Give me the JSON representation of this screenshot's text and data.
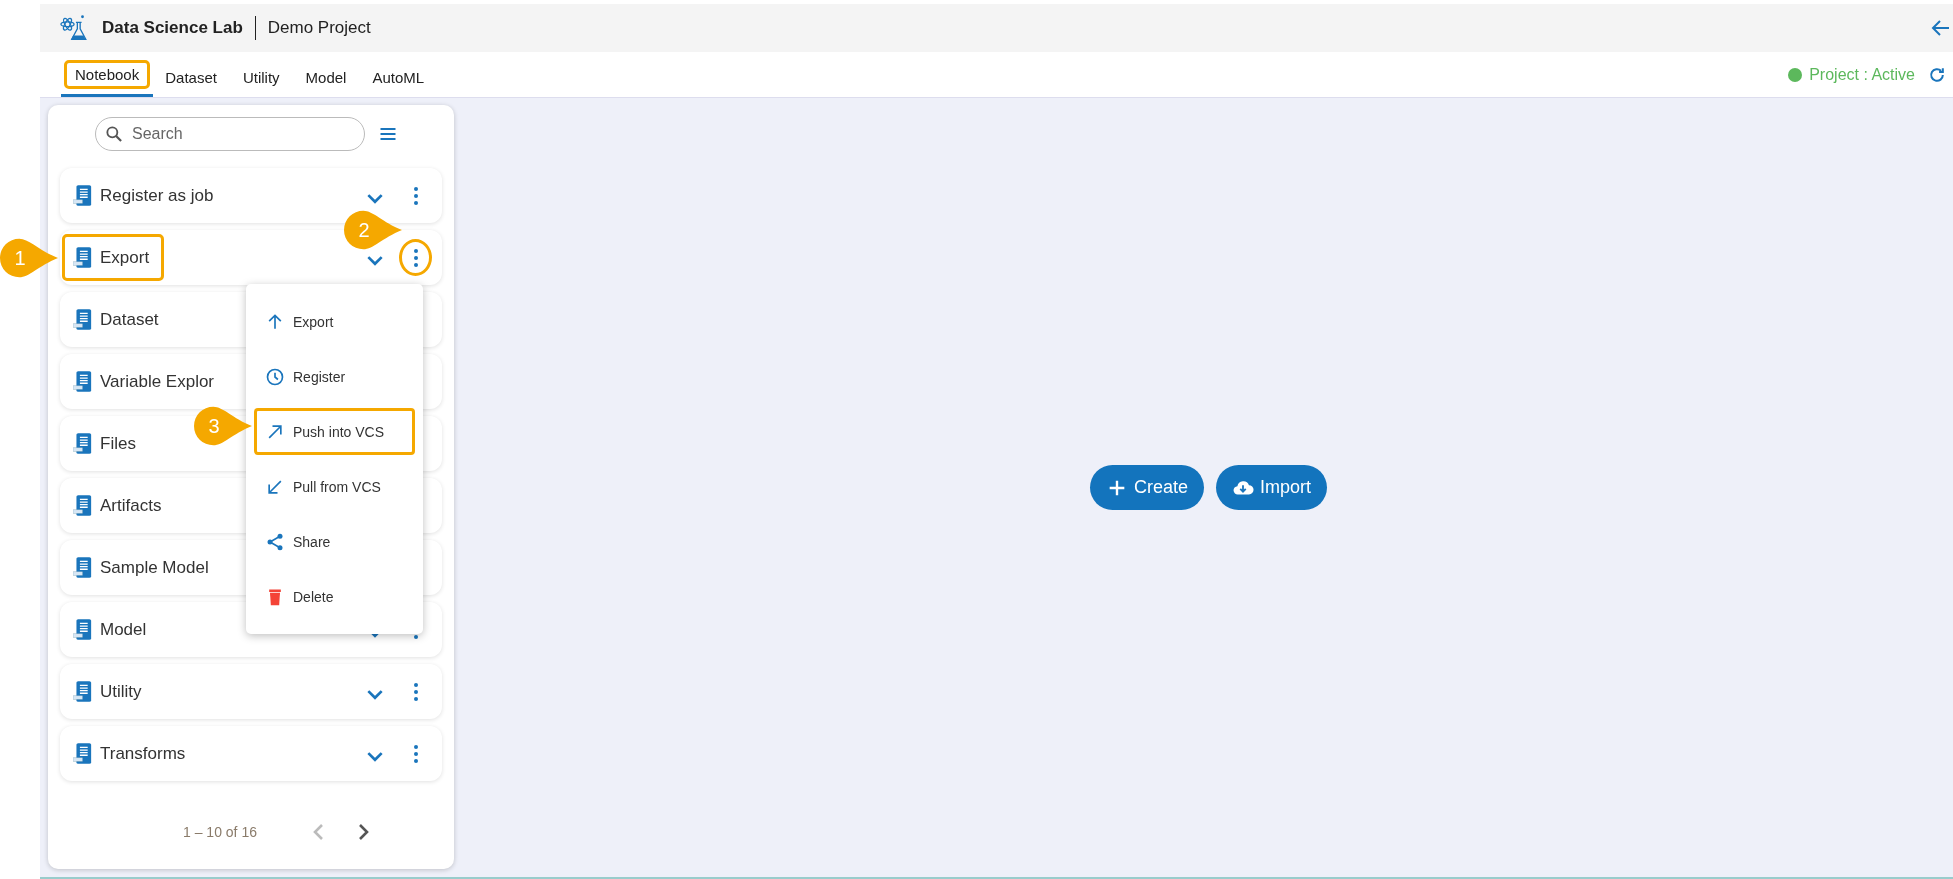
{
  "header": {
    "app_title": "Data Science Lab",
    "project_name": "Demo Project"
  },
  "tabs": [
    {
      "label": "Notebook",
      "selected": true,
      "highlighted": true
    },
    {
      "label": "Dataset",
      "selected": false,
      "highlighted": false
    },
    {
      "label": "Utility",
      "selected": false,
      "highlighted": false
    },
    {
      "label": "Model",
      "selected": false,
      "highlighted": false
    },
    {
      "label": "AutoML",
      "selected": false,
      "highlighted": false
    }
  ],
  "project_status": {
    "label": "Project : Active",
    "color": "#5cb85c"
  },
  "search": {
    "placeholder": "Search"
  },
  "notebooks": [
    {
      "name": "Register as job",
      "controls": true
    },
    {
      "name": "Export",
      "controls": true,
      "label_callout": "1",
      "more_callout": "2"
    },
    {
      "name": "Dataset"
    },
    {
      "name": "Variable Explor"
    },
    {
      "name": "Files"
    },
    {
      "name": "Artifacts"
    },
    {
      "name": "Sample Model"
    },
    {
      "name": "Model",
      "controls": true
    },
    {
      "name": "Utility",
      "controls": true
    },
    {
      "name": "Transforms",
      "controls": true
    }
  ],
  "context_menu": [
    {
      "kind": "export",
      "label": "Export",
      "highlighted": false
    },
    {
      "kind": "register",
      "label": "Register",
      "highlighted": false
    },
    {
      "kind": "push",
      "label": "Push into VCS",
      "highlighted": true,
      "callout": "3"
    },
    {
      "kind": "pull",
      "label": "Pull from VCS",
      "highlighted": false
    },
    {
      "kind": "share",
      "label": "Share",
      "highlighted": false
    },
    {
      "kind": "delete",
      "label": "Delete",
      "highlighted": false
    }
  ],
  "pagination": {
    "range": "1 – 10 of 16",
    "prev_disabled": true,
    "next_disabled": false
  },
  "actions": [
    {
      "kind": "create",
      "label": "Create"
    },
    {
      "kind": "import",
      "label": "Import"
    }
  ]
}
